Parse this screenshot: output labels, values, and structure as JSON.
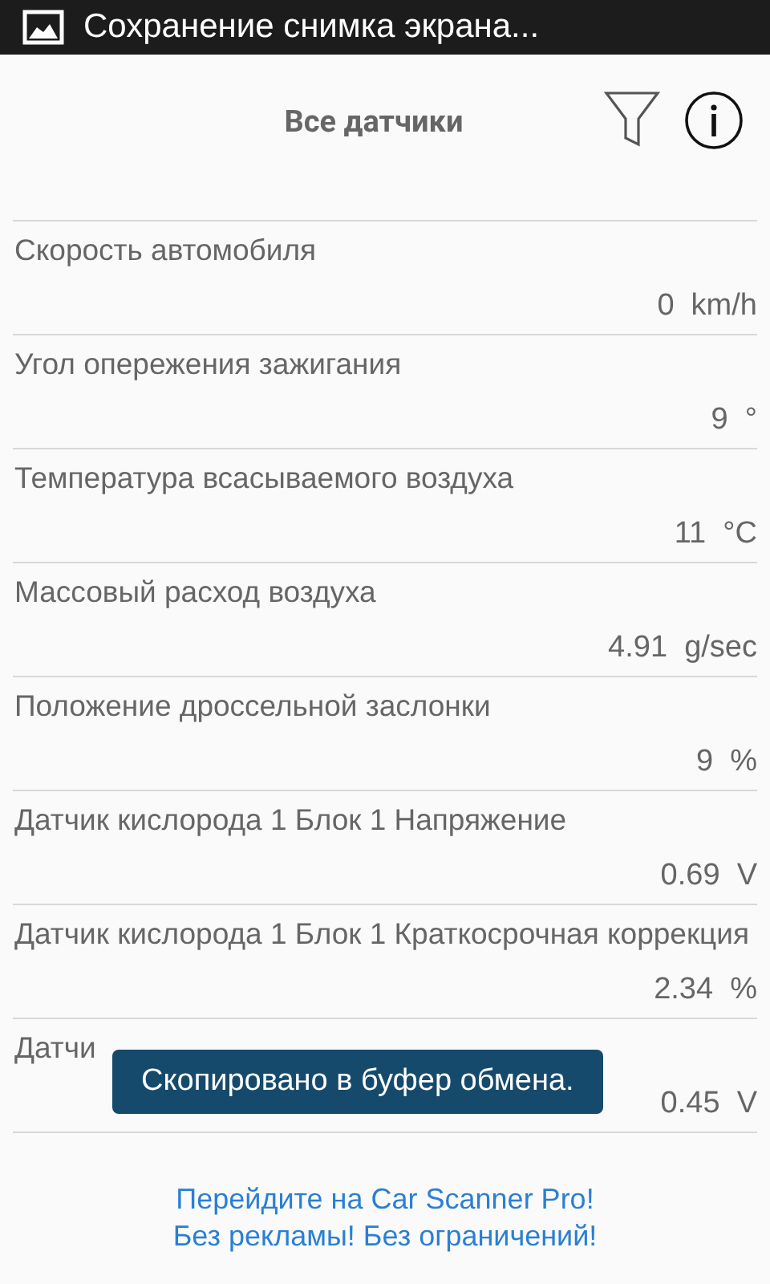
{
  "status_bar": {
    "notification": "Сохранение снимка экрана..."
  },
  "header": {
    "title": "Все датчики"
  },
  "sensors": [
    {
      "name": "Скорость автомобиля",
      "value": "0  km/h"
    },
    {
      "name": "Угол опережения зажигания",
      "value": "9  °"
    },
    {
      "name": "Температура всасываемого воздуха",
      "value": "11  °C"
    },
    {
      "name": "Массовый расход воздуха",
      "value": "4.91  g/sec"
    },
    {
      "name": "Положение дроссельной заслонки",
      "value": "9  %"
    },
    {
      "name": "Датчик кислорода 1 Блок 1 Напряжение",
      "value": "0.69  V"
    },
    {
      "name": "Датчик кислорода 1 Блок 1 Краткосрочная коррекция",
      "value": "2.34  %"
    },
    {
      "name": "Датчи",
      "value": "0.45  V"
    }
  ],
  "toast": "Скопировано в буфер обмена.",
  "promo": {
    "line_1": "Перейдите на Car Scanner Pro!",
    "line_2": "Без рекламы! Без ограничений!"
  }
}
